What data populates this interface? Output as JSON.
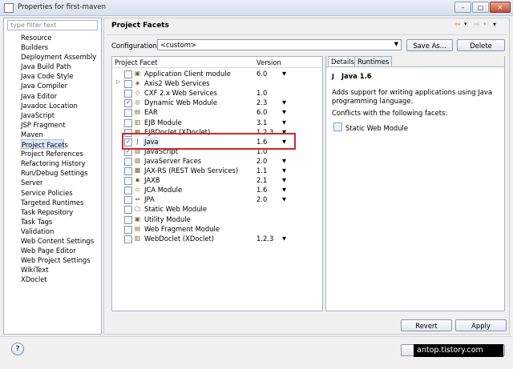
{
  "window": {
    "title": "Properties for first-maven",
    "min": "–",
    "max": "□",
    "close": "✕"
  },
  "filter": {
    "placeholder": "type filter text"
  },
  "nav": {
    "items": [
      "Resource",
      "Builders",
      "Deployment Assembly",
      "Java Build Path",
      "Java Code Style",
      "Java Compiler",
      "Java Editor",
      "Javadoc Location",
      "JavaScript",
      "JSP Fragment",
      "Maven",
      "Project Facets",
      "Project References",
      "Refactoring History",
      "Run/Debug Settings",
      "Server",
      "Service Policies",
      "Targeted Runtimes",
      "Task Repository",
      "Task Tags",
      "Validation",
      "Web Content Settings",
      "Web Page Editor",
      "Web Project Settings",
      "WikiText",
      "XDoclet"
    ],
    "selected": "Project Facets"
  },
  "page": {
    "title": "Project Facets"
  },
  "configuration": {
    "label": "Configuration:",
    "value": "<custom>",
    "save_as": "Save As...",
    "delete": "Delete"
  },
  "table": {
    "col_facet": "Project Facet",
    "col_version": "Version",
    "rows": [
      {
        "name": "Application Client module",
        "version": "6.0",
        "checked": false,
        "dropdown": true,
        "icon": "▣"
      },
      {
        "name": "Axis2 Web Services",
        "version": "",
        "checked": false,
        "dropdown": false,
        "expandable": true,
        "icon": "◈"
      },
      {
        "name": "CXF 2.x Web Services",
        "version": "1.0",
        "checked": false,
        "dropdown": false,
        "icon": "◇"
      },
      {
        "name": "Dynamic Web Module",
        "version": "2.3",
        "checked": true,
        "dropdown": true,
        "icon": "◎"
      },
      {
        "name": "EAR",
        "version": "6.0",
        "checked": false,
        "dropdown": true,
        "icon": "▤"
      },
      {
        "name": "EJB Module",
        "version": "3.1",
        "checked": false,
        "dropdown": true,
        "icon": "▥"
      },
      {
        "name": "EJBDoclet (XDoclet)",
        "version": "1.2.3",
        "checked": false,
        "dropdown": true,
        "icon": "▦"
      },
      {
        "name": "Java",
        "version": "1.6",
        "checked": true,
        "dropdown": true,
        "icon": "J",
        "highlight": true
      },
      {
        "name": "JavaScript",
        "version": "1.0",
        "checked": true,
        "dropdown": false,
        "icon": "▧"
      },
      {
        "name": "JavaServer Faces",
        "version": "2.0",
        "checked": false,
        "dropdown": true,
        "icon": "▨"
      },
      {
        "name": "JAX-RS (REST Web Services)",
        "version": "1.1",
        "checked": false,
        "dropdown": true,
        "icon": "▩"
      },
      {
        "name": "JAXB",
        "version": "2.1",
        "checked": false,
        "dropdown": true,
        "icon": "▪"
      },
      {
        "name": "JCA Module",
        "version": "1.6",
        "checked": false,
        "dropdown": true,
        "icon": "▫"
      },
      {
        "name": "JPA",
        "version": "2.0",
        "checked": false,
        "dropdown": true,
        "icon": "⇔"
      },
      {
        "name": "Static Web Module",
        "version": "",
        "checked": false,
        "dropdown": false,
        "icon": "▢"
      },
      {
        "name": "Utility Module",
        "version": "",
        "checked": false,
        "dropdown": false,
        "icon": "▣"
      },
      {
        "name": "Web Fragment Module",
        "version": "",
        "checked": false,
        "dropdown": false,
        "icon": "▤"
      },
      {
        "name": "WebDoclet (XDoclet)",
        "version": "1.2.3",
        "checked": false,
        "dropdown": true,
        "icon": "▥"
      }
    ]
  },
  "details": {
    "tab_details": "Details",
    "tab_runtimes": "Runtimes",
    "title": "Java 1.6",
    "description": "Adds support for writing applications using Java programming language.",
    "conflicts_label": "Conflicts with the following facets:",
    "conflicts": [
      "Static Web Module"
    ]
  },
  "buttons": {
    "revert": "Revert",
    "apply": "Apply",
    "help": "?"
  },
  "watermark": "antop.tistory.com"
}
